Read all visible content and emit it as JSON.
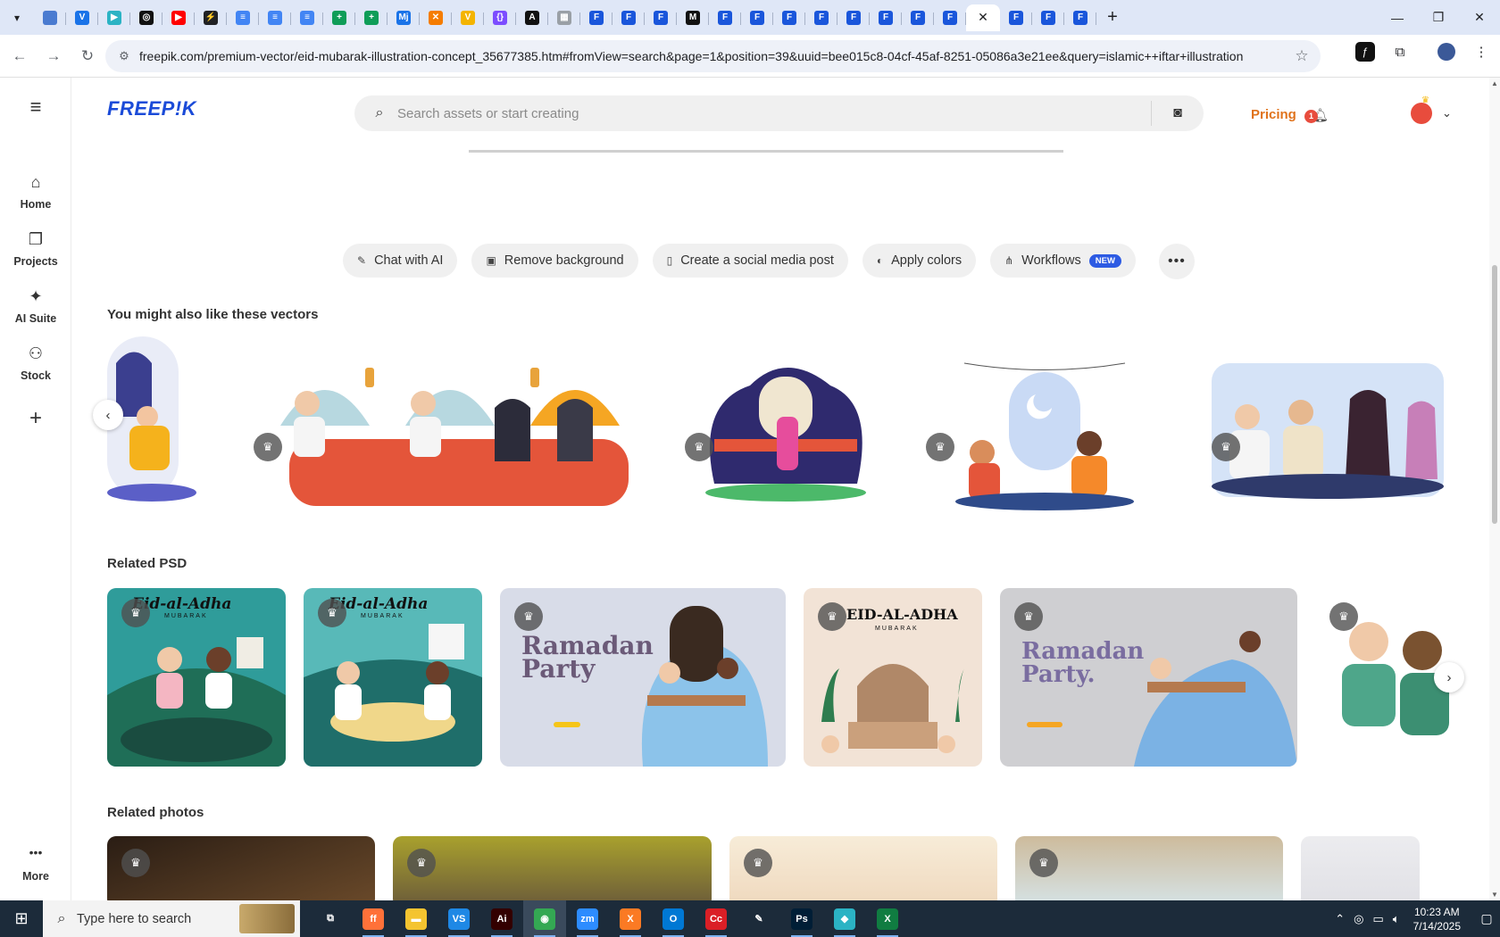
{
  "browser": {
    "tabs": [
      {
        "icon": "edge-icon",
        "color": "#4a7bd0",
        "label": ""
      },
      {
        "icon": "vpn-icon",
        "color": "#1a73e8",
        "label": "V"
      },
      {
        "icon": "arrow-icon",
        "color": "#2bb3c4",
        "label": "▶"
      },
      {
        "icon": "openai-icon",
        "color": "#111111",
        "label": "◎"
      },
      {
        "icon": "youtube-icon",
        "color": "#ff0000",
        "label": "▶"
      },
      {
        "icon": "bolt-icon",
        "color": "#202124",
        "label": "⚡"
      },
      {
        "icon": "docs-icon",
        "color": "#4285f4",
        "label": "≡"
      },
      {
        "icon": "docs-icon",
        "color": "#4285f4",
        "label": "≡"
      },
      {
        "icon": "docs-icon",
        "color": "#4285f4",
        "label": "≡"
      },
      {
        "icon": "sheets-icon",
        "color": "#0f9d58",
        "label": "+"
      },
      {
        "icon": "sheets-icon",
        "color": "#0f9d58",
        "label": "+"
      },
      {
        "icon": "mj-icon",
        "color": "#1a73e8",
        "label": "Mj"
      },
      {
        "icon": "x-icon",
        "color": "#f57c00",
        "label": "✕"
      },
      {
        "icon": "v-icon",
        "color": "#f4b400",
        "label": "V"
      },
      {
        "icon": "code-icon",
        "color": "#7c4dff",
        "label": "{}"
      },
      {
        "icon": "a-icon",
        "color": "#111111",
        "label": "A"
      },
      {
        "icon": "grid-icon",
        "color": "#9aa0a6",
        "label": "▦"
      },
      {
        "icon": "forms-icon",
        "color": "#1a56db",
        "label": "F"
      },
      {
        "icon": "forms-icon",
        "color": "#1a56db",
        "label": "F"
      },
      {
        "icon": "forms-icon",
        "color": "#1a56db",
        "label": "F"
      },
      {
        "icon": "m-icon",
        "color": "#111111",
        "label": "M"
      },
      {
        "icon": "forms-icon",
        "color": "#1a56db",
        "label": "F"
      },
      {
        "icon": "forms-icon",
        "color": "#1a56db",
        "label": "F"
      },
      {
        "icon": "forms-icon",
        "color": "#1a56db",
        "label": "F"
      },
      {
        "icon": "forms-icon",
        "color": "#1a56db",
        "label": "F"
      },
      {
        "icon": "forms-icon",
        "color": "#1a56db",
        "label": "F"
      },
      {
        "icon": "forms-icon",
        "color": "#1a56db",
        "label": "F"
      },
      {
        "icon": "forms-icon",
        "color": "#1a56db",
        "label": "F"
      },
      {
        "icon": "forms-icon",
        "color": "#1a56db",
        "label": "F"
      }
    ],
    "tabs_after": [
      {
        "icon": "forms-icon",
        "color": "#1a56db",
        "label": "F"
      },
      {
        "icon": "forms-icon",
        "color": "#1a56db",
        "label": "F"
      },
      {
        "icon": "forms-icon",
        "color": "#1a56db",
        "label": "F"
      }
    ],
    "active_tab_close": "✕",
    "new_tab": "+",
    "window_controls": {
      "minimize": "—",
      "restore": "❐",
      "close": "✕"
    },
    "url": "freepik.com/premium-vector/eid-mubarak-illustration-concept_35677385.htm#fromView=search&page=1&position=39&uuid=bee015c8-04cf-45af-8251-05086a3e21ee&query=islamic++iftar+illustration"
  },
  "sidebar": {
    "items": [
      {
        "icon": "⌂",
        "label": "Home",
        "name": "home"
      },
      {
        "icon": "❐",
        "label": "Projects",
        "name": "projects"
      },
      {
        "icon": "✦",
        "label": "AI Suite",
        "name": "ai-suite"
      },
      {
        "icon": "⚇",
        "label": "Stock",
        "name": "stock"
      }
    ],
    "plus": "+",
    "more_icon": "•••",
    "more_label": "More"
  },
  "header": {
    "logo": "FREEP!K",
    "search_placeholder": "Search assets or start creating",
    "pricing": "Pricing",
    "notification_count": "1"
  },
  "actions": [
    {
      "icon": "✎",
      "label": "Chat with AI",
      "name": "chat-with-ai"
    },
    {
      "icon": "▣",
      "label": "Remove background",
      "name": "remove-background"
    },
    {
      "icon": "▯",
      "label": "Create a social media post",
      "name": "create-social-post"
    },
    {
      "icon": "◐",
      "label": "Apply colors",
      "name": "apply-colors"
    },
    {
      "icon": "⋔",
      "label": "Workflows",
      "name": "workflows",
      "badge": "NEW"
    }
  ],
  "sections": {
    "vectors": "You might also like these vectors",
    "psd": "Related PSD",
    "photos": "Related photos"
  },
  "psd_cards": [
    {
      "title": "Eid-al-Adha",
      "subtitle": "MUBARAK"
    },
    {
      "title": "Eid-al-Adha",
      "subtitle": "MUBARAK"
    },
    {
      "title": "Ramadan Party",
      "subtitle": ""
    },
    {
      "title": "EID-AL-ADHA",
      "subtitle": "MUBARAK"
    },
    {
      "title": "Ramadan Party.",
      "subtitle": ""
    }
  ],
  "taskbar": {
    "search_placeholder": "Type here to search",
    "time": "10:23 AM",
    "date": "7/14/2025",
    "apps": [
      {
        "name": "task-view",
        "color": "#1c2b3a",
        "label": "⧉"
      },
      {
        "name": "firefox",
        "color": "#ff7139",
        "label": "ff"
      },
      {
        "name": "file-explorer",
        "color": "#f4c430",
        "label": "▬"
      },
      {
        "name": "vscode",
        "color": "#1e88e5",
        "label": "VS"
      },
      {
        "name": "illustrator",
        "color": "#330000",
        "label": "Ai"
      },
      {
        "name": "chrome",
        "color": "#34a853",
        "label": "◉"
      },
      {
        "name": "zoom",
        "color": "#2d8cff",
        "label": "zm"
      },
      {
        "name": "xampp",
        "color": "#fb7a24",
        "label": "X"
      },
      {
        "name": "outlook",
        "color": "#0078d4",
        "label": "O"
      },
      {
        "name": "creative-cloud",
        "color": "#da1f26",
        "label": "Cc"
      },
      {
        "name": "pen-tool",
        "color": "#1c2b3a",
        "label": "✎"
      },
      {
        "name": "photoshop",
        "color": "#001e36",
        "label": "Ps"
      },
      {
        "name": "app-diamond",
        "color": "#2bb3c4",
        "label": "◆"
      },
      {
        "name": "excel",
        "color": "#107c41",
        "label": "X"
      }
    ]
  }
}
